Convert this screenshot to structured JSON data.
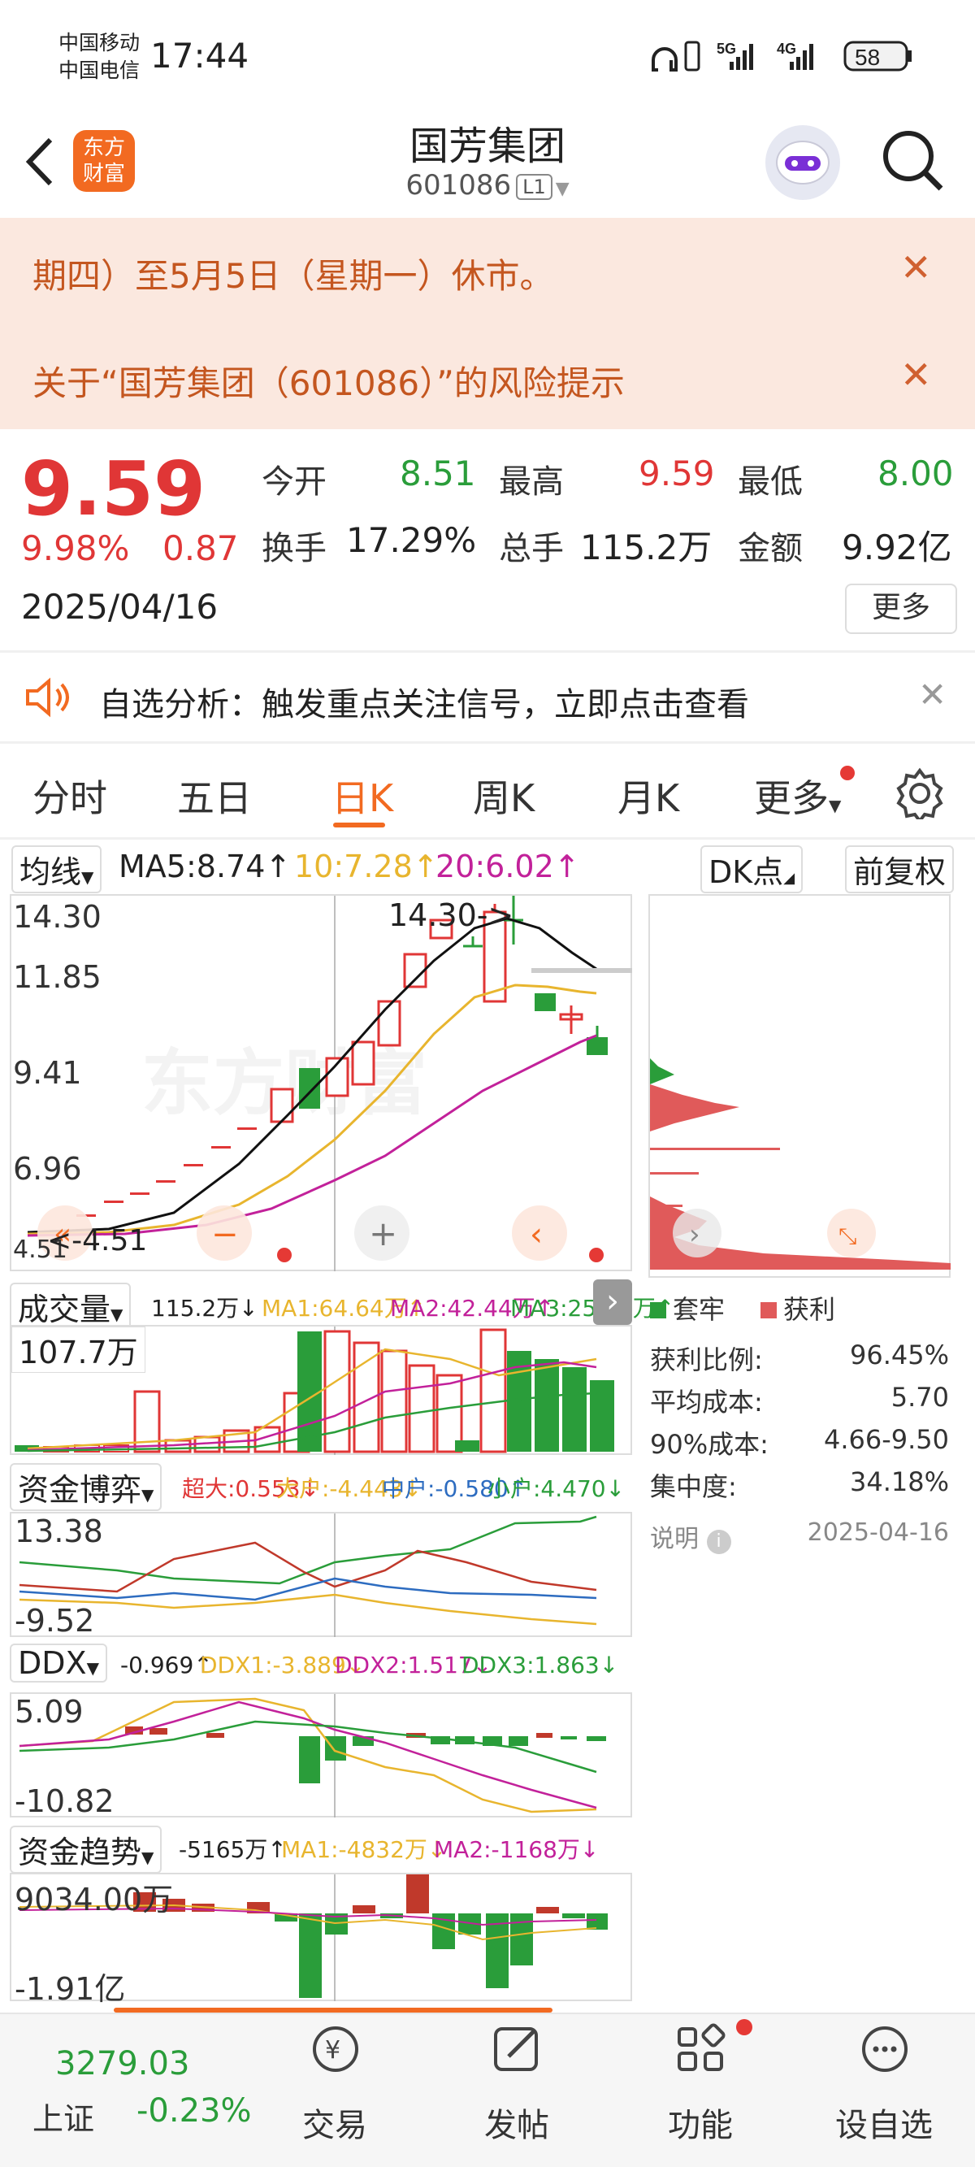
{
  "status_bar": {
    "carrier1": "中国移动",
    "carrier2": "中国电信",
    "time": "17:44",
    "net1": "5G",
    "net2": "4G",
    "battery": "58"
  },
  "header": {
    "title": "国芳集团",
    "code": "601086",
    "level": "L1",
    "logo_line1": "东方",
    "logo_line2": "财富"
  },
  "notices": [
    "期四）至5月5日（星期一）休市。",
    "关于“国芳集团（601086）”的风险提示"
  ],
  "quote": {
    "price": "9.59",
    "change_pct": "9.98%",
    "change": "0.87",
    "date": "2025/04/16",
    "open_label": "今开",
    "open": "8.51",
    "high_label": "最高",
    "high": "9.59",
    "low_label": "最低",
    "low": "8.00",
    "turnover_label": "换手",
    "turnover": "17.29%",
    "volume_label": "总手",
    "volume": "115.2万",
    "amount_label": "金额",
    "amount": "9.92亿",
    "more": "更多"
  },
  "alert": {
    "text": "自选分析：触发重点关注信号，立即点击查看"
  },
  "tabs": [
    "分时",
    "五日",
    "日K",
    "周K",
    "月K",
    "更多"
  ],
  "active_tab": "日K",
  "kline": {
    "ma_select": "均线",
    "ma5": "MA5:8.74↑",
    "ma10": "10:7.28↑",
    "ma20": "20:6.02↑",
    "dk": "DK点",
    "restore": "前复权",
    "y_labels": [
      "14.30",
      "11.85",
      "9.41",
      "6.96",
      "4.51"
    ],
    "high_mark": "14.30->",
    "low_mark": "<-4.51"
  },
  "volume": {
    "select": "成交量",
    "value": "115.2万↓",
    "ma1": "MA1:64.64万↑",
    "ma2": "MA2:42.44万↑",
    "ma3": "MA3:25.59万↑",
    "top": "107.7万"
  },
  "fund": {
    "select": "资金博弈",
    "super": "超大:0.553↓",
    "large": "大户:-4.443↓",
    "mid": "中户:-0.580↑",
    "small": "小户:4.470↓",
    "y_top": "13.38",
    "y_bot": "-9.52"
  },
  "ddx": {
    "select": "DDX",
    "v": "-0.969↑",
    "d1": "DDX1:-3.889↓",
    "d2": "DDX2:1.517↓",
    "d3": "DDX3:1.863↓",
    "y_top": "5.09",
    "y_bot": "-10.82"
  },
  "trend": {
    "select": "资金趋势",
    "v": "-5165万↑",
    "ma1": "MA1:-4832万↓",
    "ma2": "MA2:-1168万↓",
    "y_top": "9034.00万",
    "y_bot": "-1.91亿"
  },
  "chips": {
    "legend_trap": "套牢",
    "legend_profit": "获利",
    "rows": [
      {
        "label": "获利比例:",
        "value": "96.45%"
      },
      {
        "label": "平均成本:",
        "value": "5.70"
      },
      {
        "label": "90%成本:",
        "value": "4.66-9.50"
      },
      {
        "label": "集中度:",
        "value": "34.18%"
      }
    ],
    "explain": "说明",
    "date": "2025-04-16"
  },
  "bottom": {
    "index_value": "3279.03",
    "index_name": "上证",
    "index_change": "-0.23%",
    "items": [
      "交易",
      "发帖",
      "功能",
      "设自选"
    ]
  },
  "colors": {
    "up": "#e03636",
    "down": "#2a9d3a",
    "ma5": "#111111",
    "ma10": "#e8b52e",
    "ma20": "#c2219a",
    "accent": "#f26a21"
  }
}
